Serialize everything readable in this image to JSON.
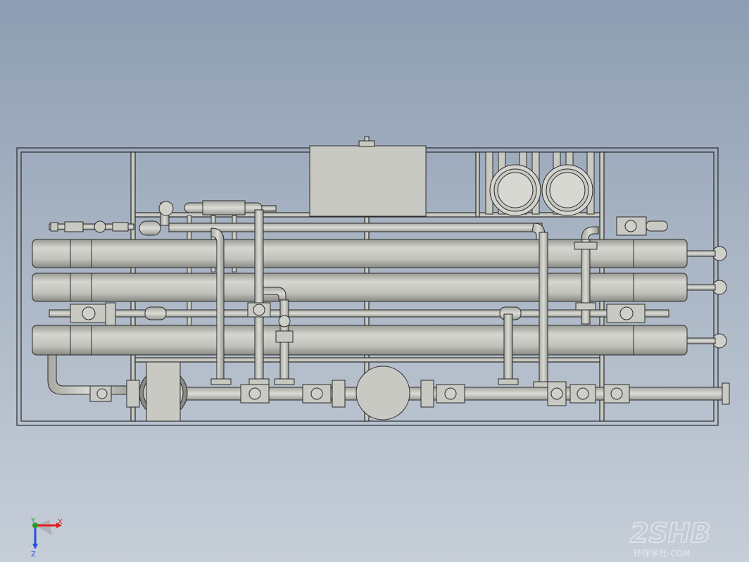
{
  "viewport": {
    "background_top": "#8e9db2",
    "background_bottom": "#c6ced8",
    "part_color": "#c9c9c3",
    "edge_color": "#2a2a2a"
  },
  "triad": {
    "x_label": "X",
    "y_label": "Y",
    "z_label": "Z",
    "x_color": "#e02020",
    "y_color": "#20a020",
    "z_color": "#2050e0"
  },
  "watermark": {
    "main": "2SHB",
    "sub": "环保学社-COM"
  }
}
